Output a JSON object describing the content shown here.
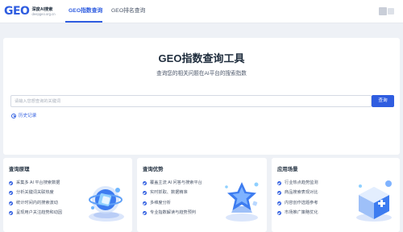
{
  "header": {
    "logo_mark": "GEO",
    "logo_name": "深度AI搜索",
    "logo_domain": "deepgeo.org.cn",
    "tabs": [
      {
        "label": "GEO指数查询",
        "active": true
      },
      {
        "label": "GEO排名查询",
        "active": false
      }
    ]
  },
  "search": {
    "title": "GEO指数查询工具",
    "subtitle": "查询您的相关问题在AI平台的搜索指数",
    "placeholder": "请输入您想查询的关键词",
    "button_label": "查询",
    "history_label": "历史记录"
  },
  "cards": [
    {
      "title": "查询原理",
      "items": [
        "采集多 AI 平台搜索数据",
        "分析关键词关联热度",
        "统计时间内的搜索波动",
        "呈现用户关注趋势和动因"
      ],
      "icon": "globe-cube-illustration"
    },
    {
      "title": "查询优势",
      "items": [
        "覆盖主流 AI 问答与搜索平台",
        "实时抓取、数据精准",
        "多维度分析",
        "专业指数解读与趋势预判"
      ],
      "icon": "star-trophy-illustration"
    },
    {
      "title": "应用场景",
      "items": [
        "行业热点趋势监测",
        "商品搜索表现对比",
        "内容创作选题参考",
        "市场推广策略优化"
      ],
      "icon": "medical-box-illustration"
    }
  ],
  "colors": {
    "accent": "#2f5de0",
    "background": "#eef1f6",
    "panel": "#ffffff"
  }
}
